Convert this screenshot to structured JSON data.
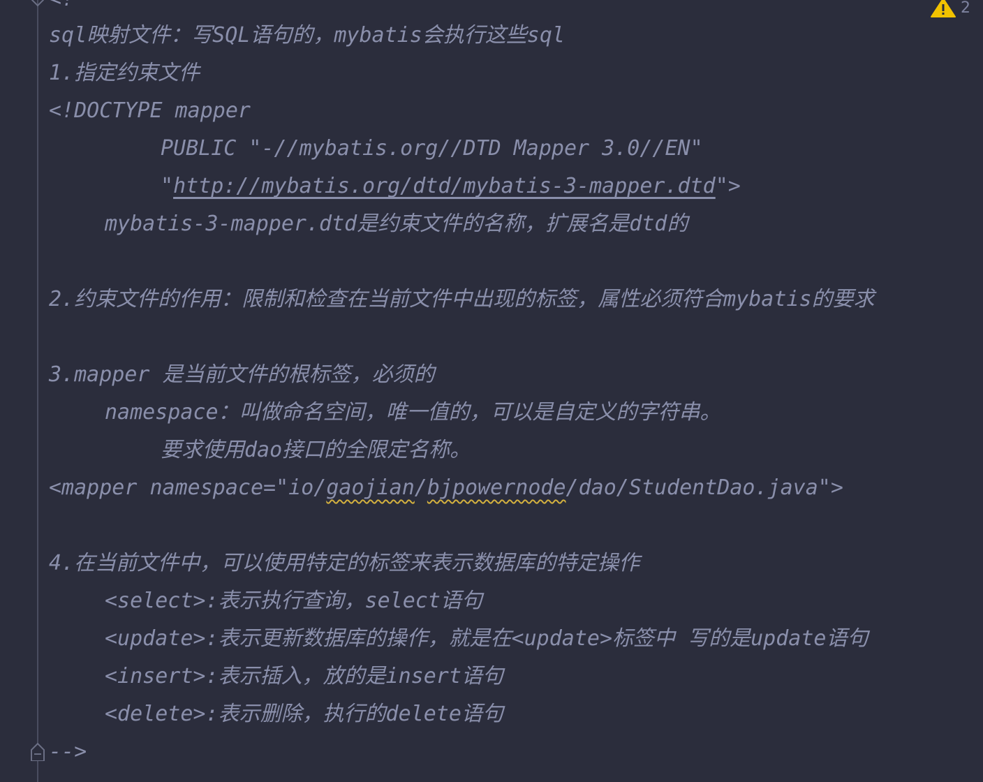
{
  "top_partial": "<!",
  "warning": {
    "count": "2",
    "icon": "warning-triangle-icon",
    "color": "#f2c200"
  },
  "lines": {
    "l1": "sql映射文件：写SQL语句的，mybatis会执行这些sql",
    "l2": "1.指定约束文件",
    "l3": "<!DOCTYPE mapper",
    "l4": "PUBLIC \"-//mybatis.org//DTD Mapper 3.0//EN\"",
    "l5_q1": "\"",
    "l5_url": "http://mybatis.org/dtd/mybatis-3-mapper.dtd",
    "l5_end": "\">",
    "l6": "mybatis-3-mapper.dtd是约束文件的名称，扩展名是dtd的",
    "l7": "2.约束文件的作用：限制和检查在当前文件中出现的标签，属性必须符合mybatis的要求",
    "l8": "3.mapper 是当前文件的根标签，必须的",
    "l9": "namespace：叫做命名空间，唯一值的，可以是自定义的字符串。",
    "l10": "要求使用dao接口的全限定名称。",
    "l11_a": "<mapper namespace=\"io/",
    "l11_b": "gaojian",
    "l11_c": "/",
    "l11_d": "bjpowernode",
    "l11_e": "/dao/StudentDao.java\">",
    "l12": "4.在当前文件中，可以使用特定的标签来表示数据库的特定操作",
    "l13": "<select>:表示执行查询，select语句",
    "l14": "<update>:表示更新数据库的操作，就是在<update>标签中 写的是update语句",
    "l15": "<insert>:表示插入，放的是insert语句",
    "l16": "<delete>:表示删除，执行的delete语句",
    "l17": "-->"
  },
  "colors": {
    "background": "#2b2d3c",
    "comment": "#8a8fab",
    "squiggle": "#d4b13f"
  }
}
